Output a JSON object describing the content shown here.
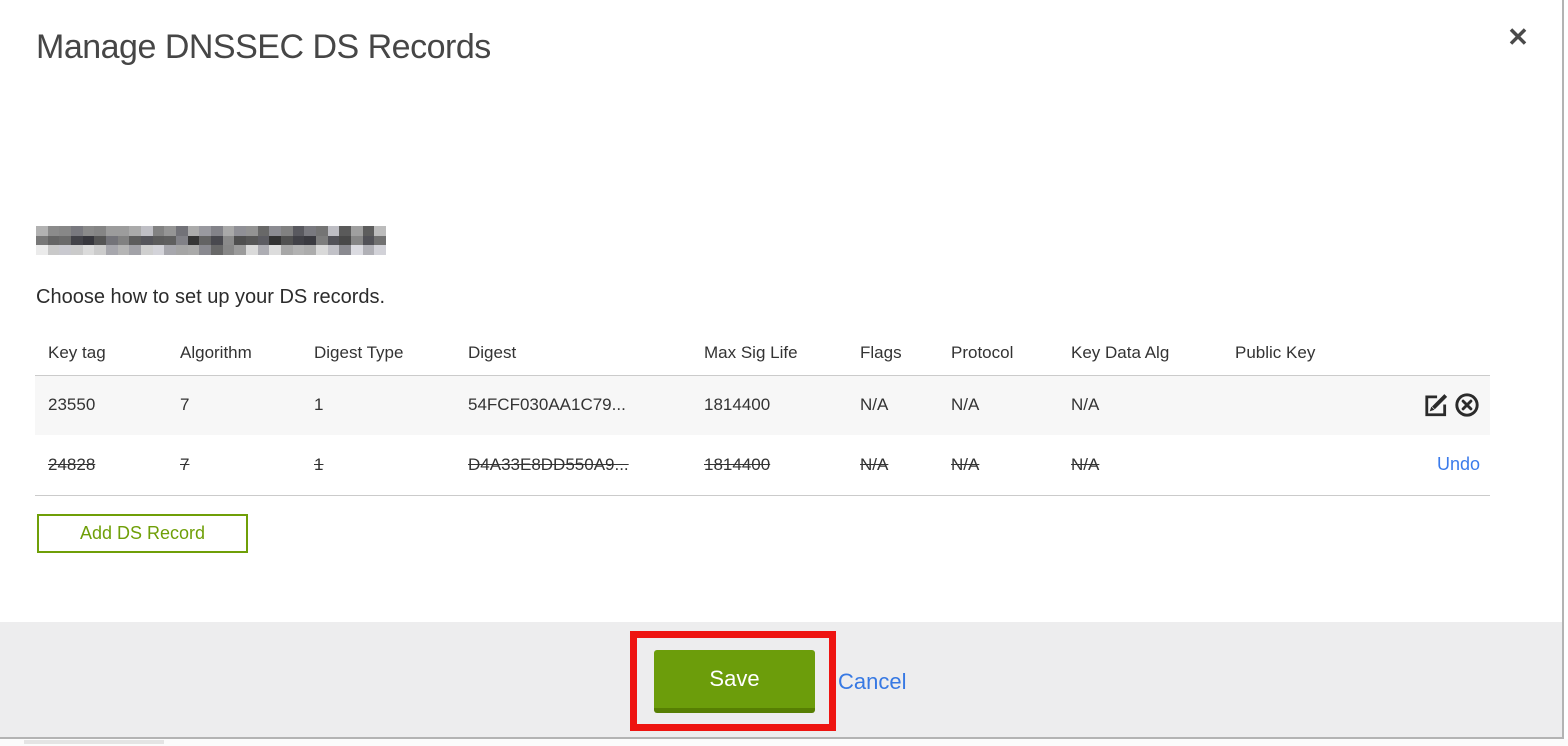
{
  "header": {
    "title": "Manage DNSSEC DS Records",
    "close_icon": "✕"
  },
  "domain": {
    "redacted": true,
    "note": "pixelated-blurred-domain-name"
  },
  "intro": "Choose how to set up your DS records.",
  "table": {
    "columns": [
      "Key tag",
      "Algorithm",
      "Digest Type",
      "Digest",
      "Max Sig Life",
      "Flags",
      "Protocol",
      "Key Data Alg",
      "Public Key"
    ],
    "rows": [
      {
        "key_tag": "23550",
        "algorithm": "7",
        "digest_type": "1",
        "digest": "54FCF030AA1C79...",
        "max_sig_life": "1814400",
        "flags": "N/A",
        "protocol": "N/A",
        "key_data_alg": "N/A",
        "public_key": "",
        "state": "normal",
        "actions": [
          "edit-icon",
          "remove-icon"
        ]
      },
      {
        "key_tag": "24828",
        "algorithm": "7",
        "digest_type": "1",
        "digest": "D4A33E8DD550A9...",
        "max_sig_life": "1814400",
        "flags": "N/A",
        "protocol": "N/A",
        "key_data_alg": "N/A",
        "public_key": "",
        "state": "deleted",
        "undo_label": "Undo"
      }
    ]
  },
  "actions": {
    "add_ds_record": "Add DS Record"
  },
  "footer": {
    "save": "Save",
    "cancel": "Cancel"
  },
  "colors": {
    "accent_green": "#6c9d0b",
    "accent_green_dark": "#577f03",
    "outline_green": "#6f9f08",
    "link_blue": "#3b7beb",
    "annotation_red": "#ee1411",
    "footer_gray": "#ededee",
    "row_highlight": "#f7f7f7"
  }
}
